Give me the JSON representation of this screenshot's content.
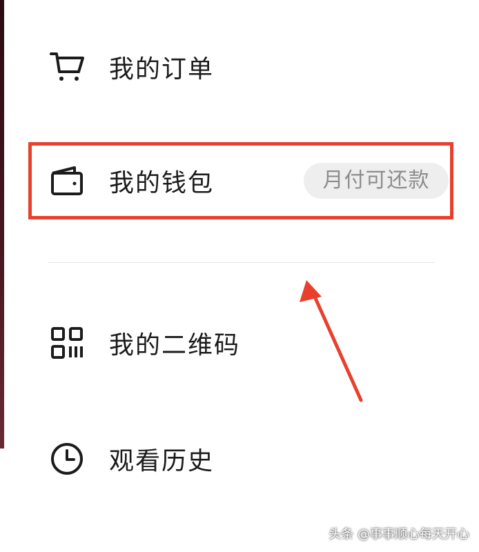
{
  "menu": {
    "items": [
      {
        "label": "我的订单",
        "icon": "shopping-cart-icon"
      },
      {
        "label": "我的钱包",
        "icon": "wallet-icon",
        "badge": "月付可还款"
      },
      {
        "label": "我的二维码",
        "icon": "qr-code-icon"
      },
      {
        "label": "观看历史",
        "icon": "clock-icon"
      }
    ]
  },
  "annotation": {
    "box_color": "#e8402c",
    "arrow_color": "#e8402c"
  },
  "watermark": {
    "text": "头条 @事事顺心每天开心"
  }
}
